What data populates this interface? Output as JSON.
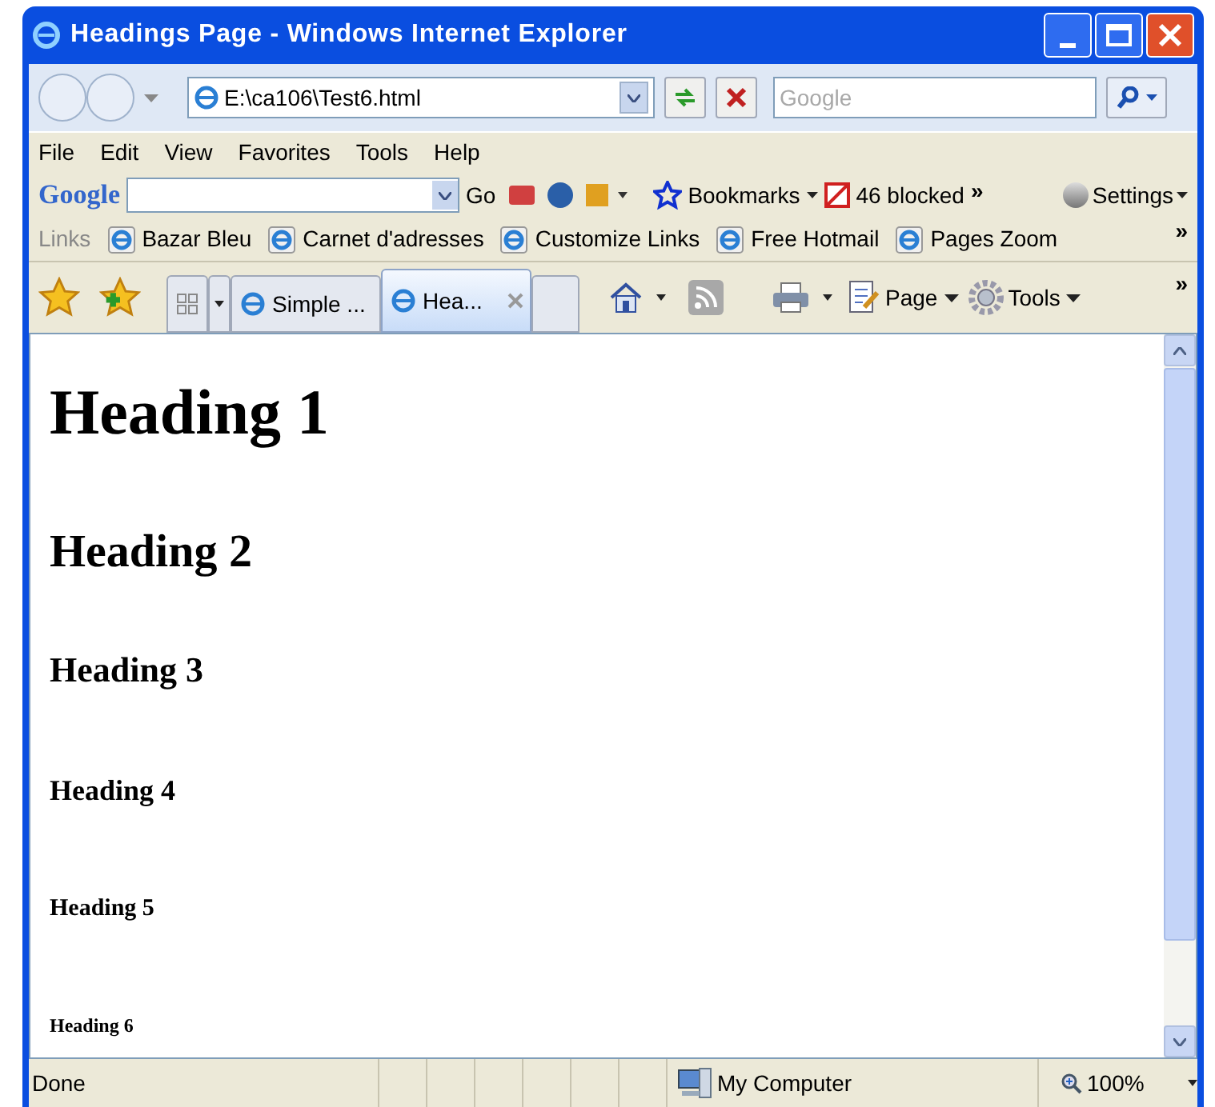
{
  "window": {
    "title": "Headings Page - Windows Internet Explorer"
  },
  "address_bar": {
    "url": "E:\\ca106\\Test6.html",
    "search_placeholder": "Google"
  },
  "menu": [
    "File",
    "Edit",
    "View",
    "Favorites",
    "Tools",
    "Help"
  ],
  "google_toolbar": {
    "logo": "Google",
    "go": "Go",
    "bookmarks": "Bookmarks",
    "blocked": "46 blocked",
    "more": "»",
    "settings": "Settings"
  },
  "links_bar": {
    "label": "Links",
    "items": [
      "Bazar Bleu",
      "Carnet d'adresses",
      "Customize Links",
      "Free Hotmail",
      "Pages Zoom"
    ],
    "more": "»"
  },
  "tabs": [
    {
      "label": "Simple ...",
      "selected": false
    },
    {
      "label": "Hea...",
      "selected": true
    }
  ],
  "command_bar": {
    "page": "Page",
    "tools": "Tools",
    "more": "»"
  },
  "content": [
    {
      "kind": "h1",
      "text": "Heading 1"
    },
    {
      "kind": "h2",
      "text": "Heading 2"
    },
    {
      "kind": "h3",
      "text": "Heading 3"
    },
    {
      "kind": "h4",
      "text": "Heading 4"
    },
    {
      "kind": "h5",
      "text": "Heading 5"
    },
    {
      "kind": "h6",
      "text": "Heading 6"
    }
  ],
  "status_bar": {
    "text": "Done",
    "zone": "My Computer",
    "zoom": "100%"
  }
}
